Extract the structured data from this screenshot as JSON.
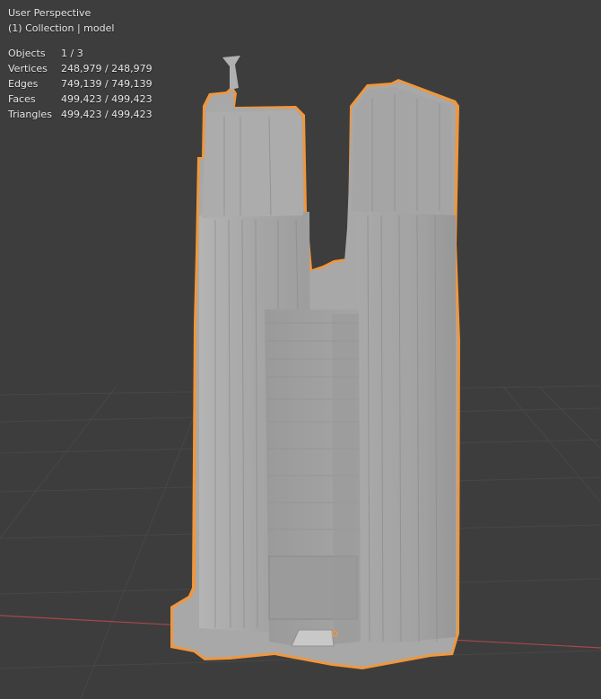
{
  "viewport": {
    "view_name": "User Perspective",
    "collection_label": "(1) Collection | model",
    "background_color": "#3d3d3d",
    "selection_outline_color": "#f0973d",
    "origin_dot_color": "#f0973d",
    "x_axis_color": "#a8474c",
    "model_color": "#a9a9a9"
  },
  "stats": [
    {
      "label": "Objects",
      "value": "1 / 3"
    },
    {
      "label": "Vertices",
      "value": "248,979 / 248,979"
    },
    {
      "label": "Edges",
      "value": "749,139 / 749,139"
    },
    {
      "label": "Faces",
      "value": "499,423 / 499,423"
    },
    {
      "label": "Triangles",
      "value": "499,423 / 499,423"
    }
  ]
}
